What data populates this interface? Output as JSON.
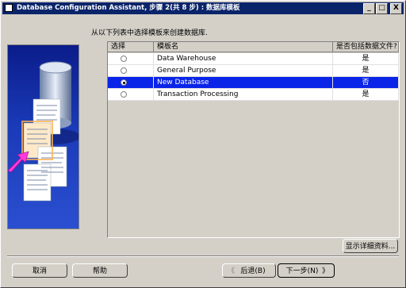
{
  "window": {
    "title": "Database Configuration Assistant, 步骤 2(共 8 步) : 数据库模板",
    "buttons": {
      "minimize": "_",
      "maximize": "□",
      "close": "X"
    }
  },
  "instruction": "从以下列表中选择模板来创建数据库.",
  "table": {
    "columns": [
      "选择",
      "模板名",
      "是否包括数据文件?"
    ],
    "rows": [
      {
        "name": "Data Warehouse",
        "includes": "是",
        "selected": false
      },
      {
        "name": "General Purpose",
        "includes": "是",
        "selected": false
      },
      {
        "name": "New Database",
        "includes": "否",
        "selected": true
      },
      {
        "name": "Transaction Processing",
        "includes": "是",
        "selected": false
      }
    ]
  },
  "details_button": "显示详细资料...",
  "footer": {
    "cancel": "取消",
    "help": "帮助",
    "back": "后退(B)",
    "next": "下一步(N)"
  },
  "colors": {
    "titlebar": "#0a246a",
    "selection": "#0a24e8",
    "face": "#d4d0c8"
  }
}
